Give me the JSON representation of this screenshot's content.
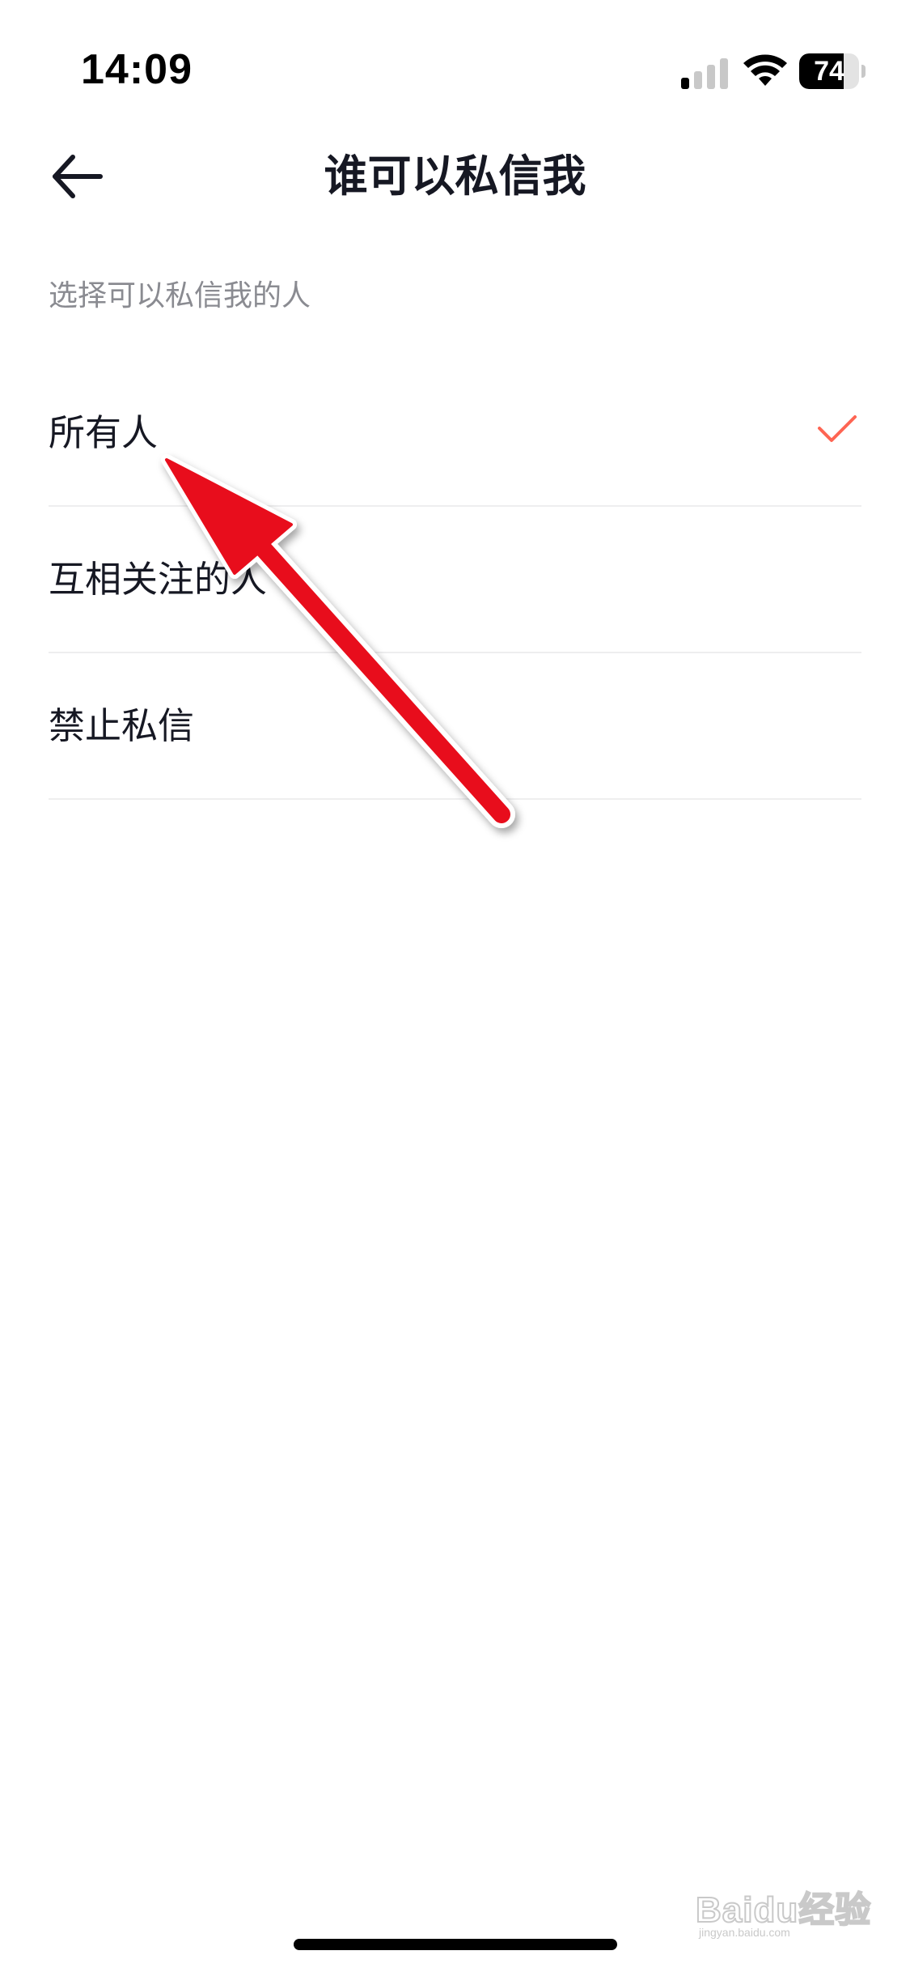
{
  "status_bar": {
    "time": "14:09",
    "battery_level": "74",
    "battery_fraction": 0.74
  },
  "nav": {
    "title": "谁可以私信我",
    "back_icon": "arrow-left-icon"
  },
  "section": {
    "subtitle": "选择可以私信我的人"
  },
  "options": [
    {
      "label": "所有人",
      "selected": true
    },
    {
      "label": "互相关注的人",
      "selected": false
    },
    {
      "label": "禁止私信",
      "selected": false
    }
  ],
  "colors": {
    "accent_check": "#fe6553",
    "annotation_arrow": "#e8101c",
    "divider": "#eeeeef",
    "subtitle_text": "#8a8b91"
  },
  "watermark": {
    "text": "Baidu经验",
    "sub": "jingyan.baidu.com"
  }
}
